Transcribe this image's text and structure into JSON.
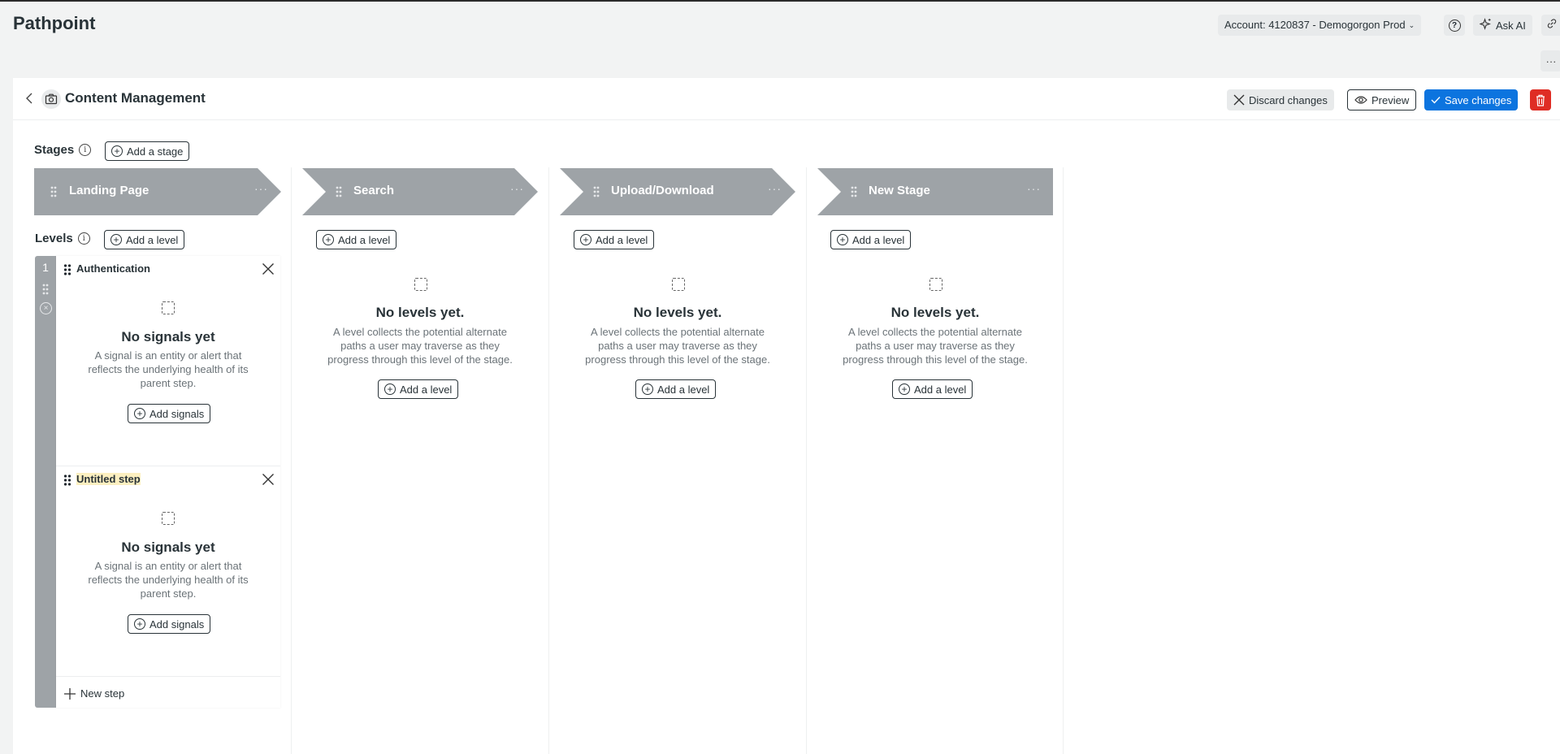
{
  "app": {
    "title": "Pathpoint"
  },
  "topbar": {
    "account_label": "Account: 4120837 - Demogorgon Prod",
    "help_icon": "question-circle-icon",
    "ask_ai_label": "Ask AI",
    "link_icon": "link-icon",
    "more_label": "···"
  },
  "header": {
    "title": "Content Management",
    "discard_label": "Discard changes",
    "preview_label": "Preview",
    "save_label": "Save changes",
    "delete_icon": "trash-icon"
  },
  "colors": {
    "accent": "#0c74df",
    "danger": "#df2d24",
    "stage": "#9ea3a7",
    "highlight": "#fcefc0"
  },
  "stages_section": {
    "label": "Stages",
    "info": "i",
    "add_stage_label": "Add a stage"
  },
  "levels_section": {
    "label": "Levels",
    "info": "i",
    "add_level_label": "Add a level"
  },
  "stages": [
    {
      "name": "Landing Page",
      "menu": "···"
    },
    {
      "name": "Search",
      "menu": "···",
      "add_level_label": "Add a level",
      "empty_title": "No levels yet.",
      "empty_desc": "A level collects the potential alternate paths a user may traverse as they progress through this level of the stage.",
      "empty_button": "Add a level"
    },
    {
      "name": "Upload/Download",
      "menu": "···",
      "add_level_label": "Add a level",
      "empty_title": "No levels yet.",
      "empty_desc": "A level collects the potential alternate paths a user may traverse as they progress through this level of the stage.",
      "empty_button": "Add a level"
    },
    {
      "name": "New Stage",
      "menu": "···",
      "add_level_label": "Add a level",
      "empty_title": "No levels yet.",
      "empty_desc": "A level collects the potential alternate paths a user may traverse as they progress through this level of the stage.",
      "empty_button": "Add a level"
    }
  ],
  "level": {
    "number": "1",
    "remove": "×",
    "steps": [
      {
        "name": "Authentication",
        "empty_title": "No signals yet",
        "empty_desc": "A signal is an entity or alert that reflects the underlying health of its parent step.",
        "button": "Add signals"
      },
      {
        "name": "Untitled step",
        "empty_title": "No signals yet",
        "empty_desc": "A signal is an entity or alert that reflects the underlying health of its parent step.",
        "button": "Add signals"
      }
    ],
    "new_step_label": "New step"
  }
}
